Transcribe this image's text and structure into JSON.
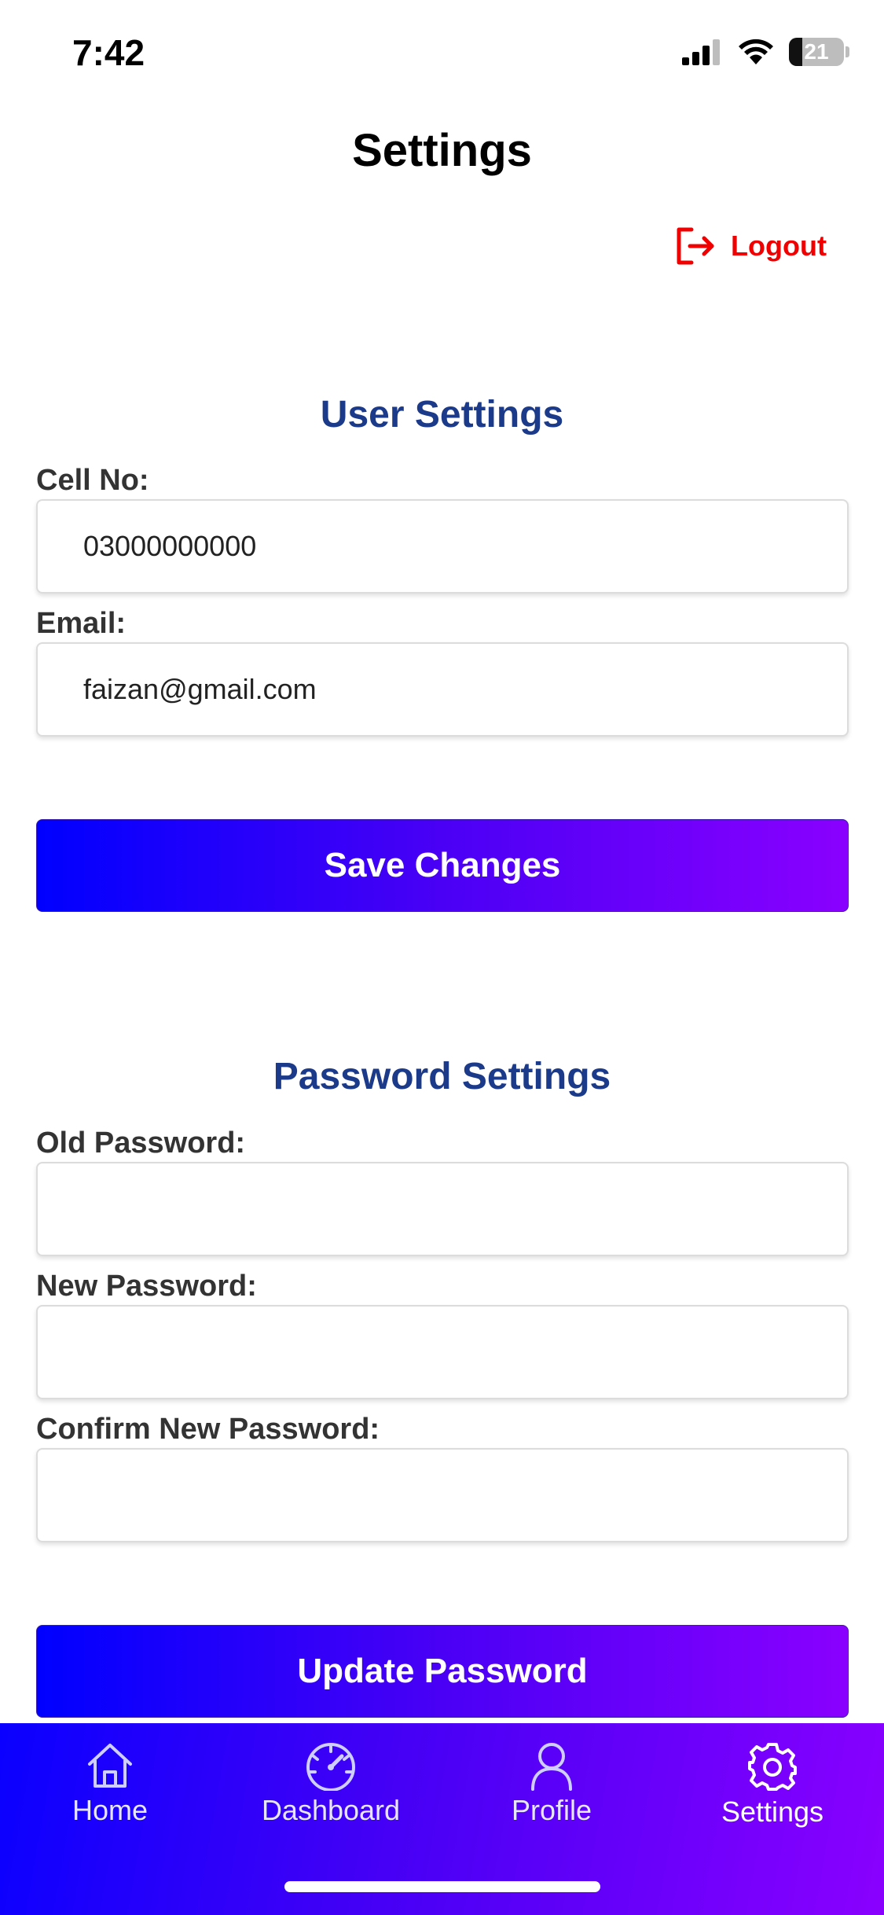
{
  "status_bar": {
    "time": "7:42",
    "battery": "21"
  },
  "header": {
    "title": "Settings",
    "logout_label": "Logout"
  },
  "user_settings": {
    "title": "User Settings",
    "cell_label": "Cell No:",
    "cell_value": "03000000000",
    "email_label": "Email:",
    "email_value": "faizan@gmail.com",
    "save_label": "Save Changes"
  },
  "password_settings": {
    "title": "Password Settings",
    "old_label": "Old Password:",
    "old_value": "",
    "new_label": "New Password:",
    "new_value": "",
    "confirm_label": "Confirm New Password:",
    "confirm_value": "",
    "update_label": "Update Password"
  },
  "tabbar": {
    "active": "Settings",
    "tabs": [
      {
        "label": "Home",
        "icon": "home-icon"
      },
      {
        "label": "Dashboard",
        "icon": "speedometer-icon"
      },
      {
        "label": "Profile",
        "icon": "person-icon"
      },
      {
        "label": "Settings",
        "icon": "gear-icon"
      }
    ]
  },
  "colors": {
    "section_title": "#1b3a8a",
    "logout": "#f00000",
    "gradient_start": "#0000ff",
    "gradient_end": "#8a00ff"
  }
}
